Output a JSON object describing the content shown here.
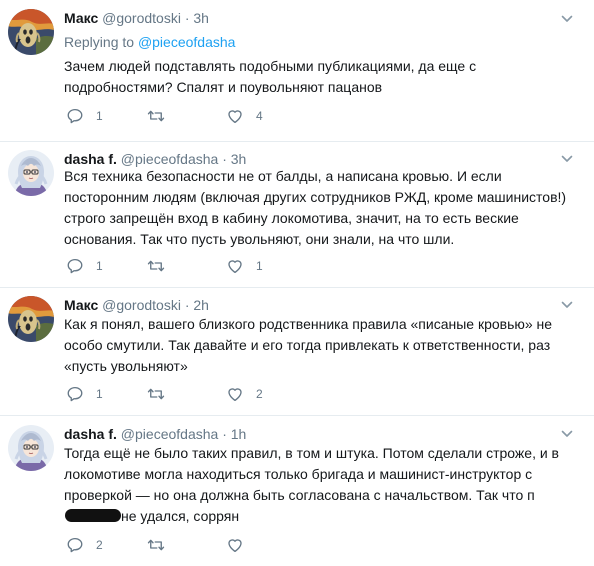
{
  "tweets": [
    {
      "name": "Макс",
      "handle": "@gorodtoski",
      "dot": "·",
      "time": "3h",
      "reply_prefix": "Replying to",
      "reply_handle": "@pieceofdasha",
      "text": "Зачем людей подставлять подобными публикациями, да еще с подробностями? Спалят и поувольняют пацанов",
      "replies": "1",
      "retweets": "",
      "likes": "4",
      "avatar": "scream-painting"
    },
    {
      "name": "dasha f.",
      "handle": "@pieceofdasha",
      "dot": "·",
      "time": "3h",
      "text": "Вся техника безопасности не от балды, а написана кровью. И если посторонним людям (включая других сотрудников РЖД, кроме машинистов!) строго запрещён вход в кабину локомотива, значит, на то есть веские основания. Так что пусть увольняют, они знали, на что шли.",
      "replies": "1",
      "retweets": "",
      "likes": "1",
      "avatar": "anime-girl"
    },
    {
      "name": "Макс",
      "handle": "@gorodtoski",
      "dot": "·",
      "time": "2h",
      "text": "Как я понял, вашего близкого родственника правила «писаные кровью» не особо смутили. Так давайте и его тогда привлекать к ответственности, раз «пусть увольняют»",
      "replies": "1",
      "retweets": "",
      "likes": "2",
      "avatar": "scream-painting"
    },
    {
      "name": "dasha f.",
      "handle": "@pieceofdasha",
      "dot": "·",
      "time": "1h",
      "text_main": "Тогда ещё не было таких правил, в том и штука. Потом сделали строже, и в локомотиве могла находиться только бригада и машинист-инструктор с проверкой — но она должна быть согласована с начальством. Так что",
      "text_tail_start": "п",
      "text_tail_end": "не удался, соррян",
      "replies": "2",
      "retweets": "",
      "likes": "",
      "avatar": "anime-girl"
    }
  ],
  "icons": {
    "reply": "reply-icon",
    "retweet": "retweet-icon",
    "like": "heart-icon",
    "menu": "chevron-down-icon"
  },
  "colors": {
    "text": "#14171a",
    "secondary": "#657786",
    "link": "#1da1f2",
    "divider": "#e6ecf0"
  }
}
